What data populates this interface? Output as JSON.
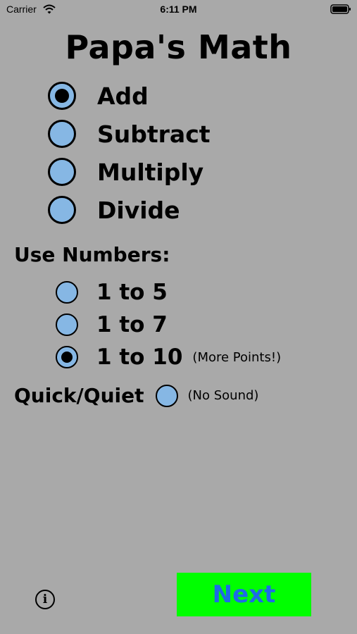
{
  "status_bar": {
    "carrier": "Carrier",
    "time": "6:11 PM"
  },
  "title": "Papa's Math",
  "operations": [
    {
      "label": "Add",
      "selected": true
    },
    {
      "label": "Subtract",
      "selected": false
    },
    {
      "label": "Multiply",
      "selected": false
    },
    {
      "label": "Divide",
      "selected": false
    }
  ],
  "numbers": {
    "label": "Use Numbers:",
    "options": [
      {
        "label": "1 to 5",
        "selected": false,
        "note": ""
      },
      {
        "label": "1 to 7",
        "selected": false,
        "note": ""
      },
      {
        "label": "1 to 10",
        "selected": true,
        "note": "(More Points!)"
      }
    ]
  },
  "quick": {
    "label": "Quick/Quiet",
    "note": "(No Sound)",
    "selected": false
  },
  "info_icon_glyph": "i",
  "next_label": "Next",
  "colors": {
    "background": "#a9a9a9",
    "radio_fill": "#86b7e4",
    "next_bg": "#00ff00",
    "next_text": "#1e6ae6"
  }
}
